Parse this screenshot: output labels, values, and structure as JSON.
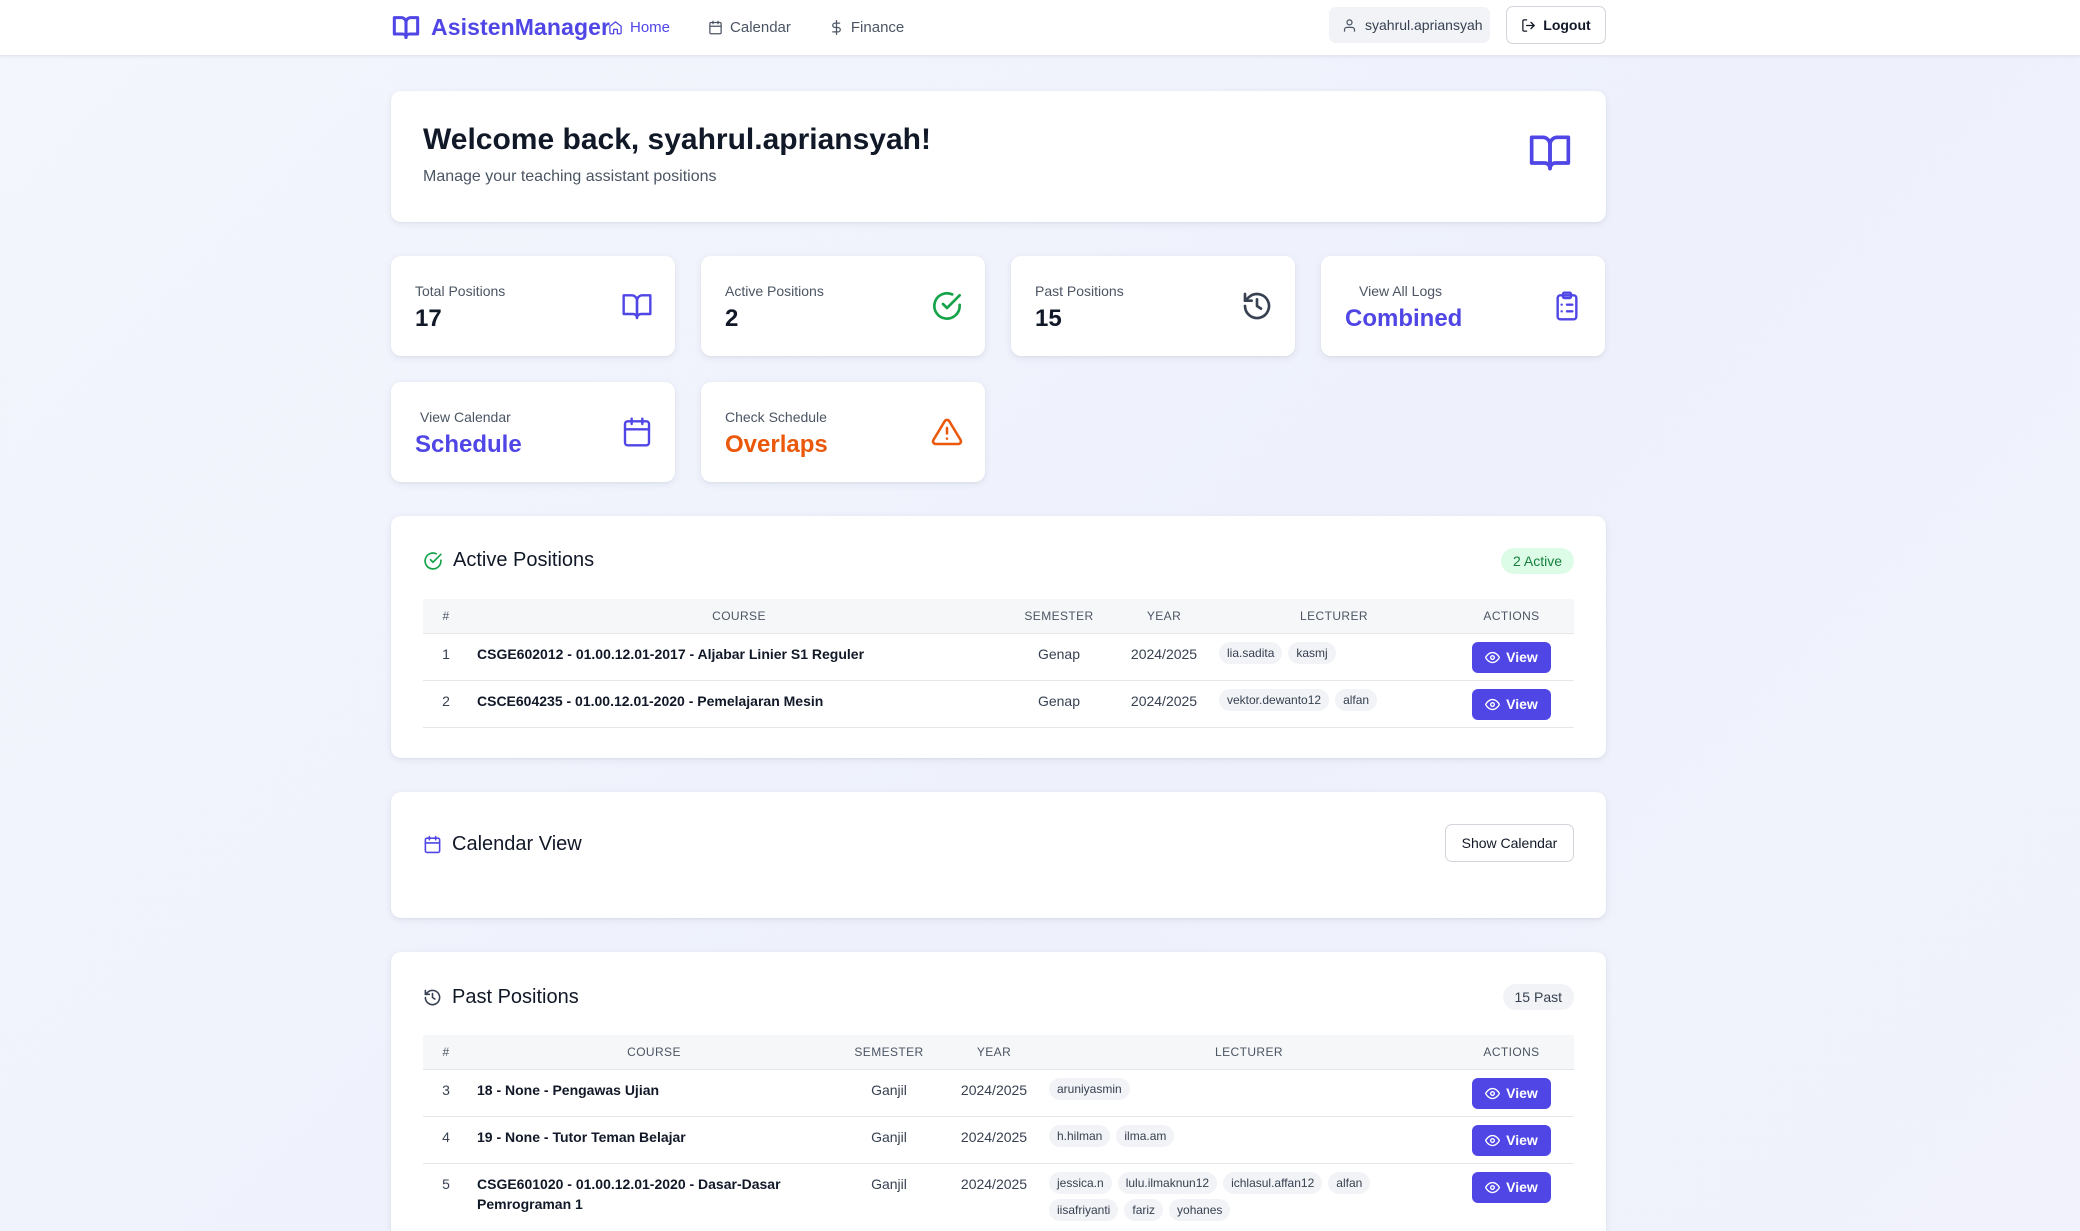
{
  "nav": {
    "brand": "AsistenManager",
    "links": [
      {
        "label": "Home",
        "icon": "home-icon",
        "active": true
      },
      {
        "label": "Calendar",
        "icon": "calendar-icon",
        "active": false
      },
      {
        "label": "Finance",
        "icon": "dollar-icon",
        "active": false
      }
    ],
    "user": "syahrul.apriansyah",
    "logout": "Logout"
  },
  "welcome": {
    "title": "Welcome back, syahrul.apriansyah!",
    "subtitle": "Manage your teaching assistant positions"
  },
  "stats": [
    {
      "label": "Total Positions",
      "value": "17",
      "icon": "book-icon",
      "color": "#4f46e5"
    },
    {
      "label": "Active Positions",
      "value": "2",
      "icon": "check-circle-icon",
      "color": "#16a34a"
    },
    {
      "label": "Past Positions",
      "value": "15",
      "icon": "history-icon",
      "color": "#374151"
    },
    {
      "label": "View All Logs",
      "value": "Combined",
      "icon": "clipboard-list-icon",
      "color": "#4f46e5"
    },
    {
      "label": "View Calendar",
      "value": "Schedule",
      "icon": "calendar-icon",
      "color": "#4f46e5"
    },
    {
      "label": "Check Schedule",
      "value": "Overlaps",
      "icon": "alert-triangle-icon",
      "color": "#ea580c"
    }
  ],
  "active": {
    "title": "Active Positions",
    "badge": "2 Active",
    "headers": [
      "#",
      "COURSE",
      "SEMESTER",
      "YEAR",
      "LECTURER",
      "ACTIONS"
    ],
    "rows": [
      {
        "num": "1",
        "course": "CSGE602012 - 01.00.12.01-2017 - Aljabar Linier S1 Reguler",
        "semester": "Genap",
        "year": "2024/2025",
        "lecturers": [
          "lia.sadita",
          "kasmj"
        ],
        "action": "View"
      },
      {
        "num": "2",
        "course": "CSCE604235 - 01.00.12.01-2020 - Pemelajaran Mesin",
        "semester": "Genap",
        "year": "2024/2025",
        "lecturers": [
          "vektor.dewanto12",
          "alfan"
        ],
        "action": "View"
      }
    ]
  },
  "calendar": {
    "title": "Calendar View",
    "button": "Show Calendar"
  },
  "past": {
    "title": "Past Positions",
    "badge": "15 Past",
    "headers": [
      "#",
      "COURSE",
      "SEMESTER",
      "YEAR",
      "LECTURER",
      "ACTIONS"
    ],
    "rows": [
      {
        "num": "3",
        "course": "18 - None - Pengawas Ujian",
        "semester": "Ganjil",
        "year": "2024/2025",
        "lecturers": [
          "aruniyasmin"
        ],
        "action": "View"
      },
      {
        "num": "4",
        "course": "19 - None - Tutor Teman Belajar",
        "semester": "Ganjil",
        "year": "2024/2025",
        "lecturers": [
          "h.hilman",
          "ilma.am"
        ],
        "action": "View"
      },
      {
        "num": "5",
        "course": "CSGE601020 - 01.00.12.01-2020 - Dasar-Dasar Pemrograman 1",
        "semester": "Ganjil",
        "year": "2024/2025",
        "lecturers": [
          "jessica.n",
          "lulu.ilmaknun12",
          "ichlasul.affan12",
          "alfan",
          "iisafriyanti",
          "fariz",
          "yohanes"
        ],
        "action": "View"
      }
    ]
  }
}
